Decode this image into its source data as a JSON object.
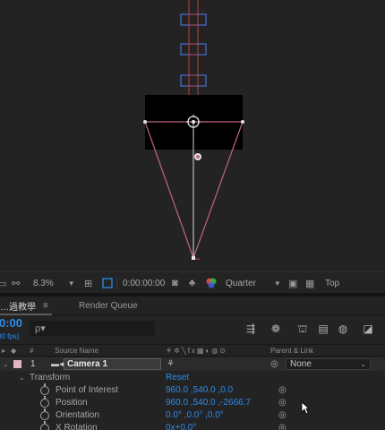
{
  "viewer": {
    "zoom": "8.3%",
    "timecode": "0:00:00:00",
    "resolution": "Quarter",
    "view": "Top"
  },
  "timeline": {
    "tabs": {
      "comp": "…過教學",
      "render_queue": "Render Queue"
    },
    "timecode": "0:00",
    "fps": "00 fps)",
    "search_icon": "ρ▾",
    "columns": {
      "number": "#",
      "source_name": "Source Name",
      "parent_link": "Parent & Link"
    },
    "layer": {
      "number": "1",
      "name": "Camera 1",
      "parent": "None",
      "label_color": "#e3b4c2"
    },
    "properties": {
      "transform": "Transform",
      "reset": "Reset",
      "point_of_interest": {
        "label": "Point of Interest",
        "value": "960.0 ,540.0 ,0.0"
      },
      "position": {
        "label": "Position",
        "value": "960.0 ,540.0 ,-2666.7"
      },
      "orientation": {
        "label": "Orientation",
        "value": "0.0° ,0.0° ,0.0°"
      },
      "x_rotation": {
        "label": "X Rotation",
        "value": "0x+0.0°"
      }
    }
  },
  "colors": {
    "accent_blue": "#2d8ceb",
    "camera_line": "#c0657e",
    "axis_red": "#c03c3c",
    "axis_blue": "#4a6fd0"
  }
}
